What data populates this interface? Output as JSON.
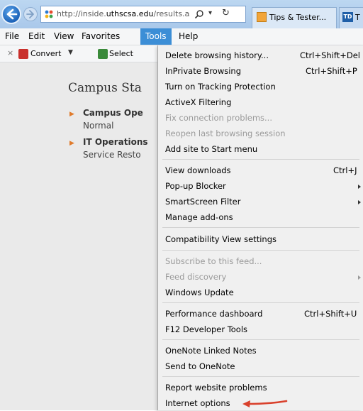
{
  "browser": {
    "address": {
      "url_prefix": "http://inside.",
      "url_host": "uthscsa.edu",
      "url_suffix": "/results.asp?c",
      "dropdown_glyph": "▾",
      "refresh_glyph": "↻"
    },
    "tabs": [
      {
        "label": "Tips & Tester...",
        "icon": "tips-favicon"
      },
      {
        "label": "T",
        "icon_text": "TD"
      }
    ]
  },
  "menubar": {
    "items": [
      "File",
      "Edit",
      "View",
      "Favorites",
      "Tools",
      "Help"
    ],
    "active": "Tools"
  },
  "command_bar": {
    "close_glyph": "×",
    "convert_label": "Convert",
    "convert_arrow": "▼",
    "select_label": "Select"
  },
  "page": {
    "title": "Campus Sta",
    "statuses": [
      {
        "heading": "Campus Ope",
        "status": "Normal"
      },
      {
        "heading": "IT Operations",
        "status": "Service Resto"
      }
    ],
    "bullet_glyph": "▶"
  },
  "tools_menu": {
    "items": [
      {
        "label": "Delete browsing history...",
        "shortcut": "Ctrl+Shift+Del"
      },
      {
        "label": "InPrivate Browsing",
        "shortcut": "Ctrl+Shift+P"
      },
      {
        "label": "Turn on Tracking Protection"
      },
      {
        "label": "ActiveX Filtering"
      },
      {
        "label": "Fix connection problems..."
      },
      {
        "label": "Reopen last browsing session"
      },
      {
        "label": "Add site to Start menu"
      },
      {
        "label": "View downloads",
        "shortcut": "Ctrl+J"
      },
      {
        "label": "Pop-up Blocker"
      },
      {
        "label": "SmartScreen Filter"
      },
      {
        "label": "Manage add-ons"
      },
      {
        "label": "Compatibility View settings"
      },
      {
        "label": "Subscribe to this feed..."
      },
      {
        "label": "Feed discovery"
      },
      {
        "label": "Windows Update"
      },
      {
        "label": "Performance dashboard",
        "shortcut": "Ctrl+Shift+U"
      },
      {
        "label": "F12 Developer Tools"
      },
      {
        "label": "OneNote Linked Notes"
      },
      {
        "label": "Send to OneNote"
      },
      {
        "label": "Report website problems"
      },
      {
        "label": "Internet options"
      }
    ]
  },
  "colors": {
    "menu_highlight": "#3c8ed6",
    "disabled_text": "#9a9a9a",
    "annotation_arrow": "#d9412c",
    "bullet": "#e07b2c"
  }
}
